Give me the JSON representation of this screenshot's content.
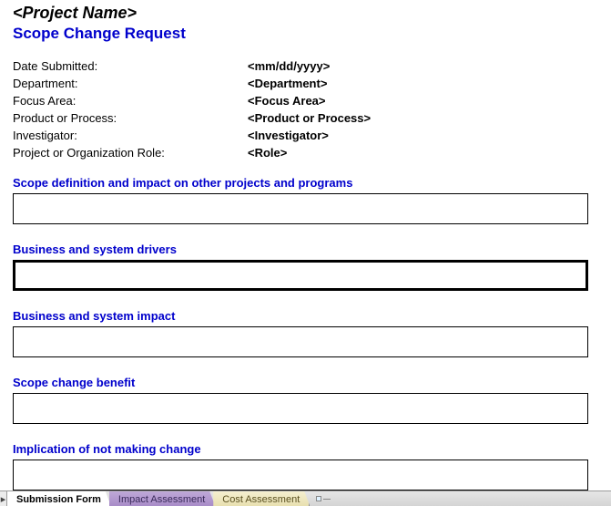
{
  "header": {
    "project_name": "<Project Name>",
    "subtitle": "Scope Change Request"
  },
  "meta": [
    {
      "label": "Date Submitted:",
      "value": "<mm/dd/yyyy>"
    },
    {
      "label": "Department:",
      "value": "<Department>"
    },
    {
      "label": "Focus Area:",
      "value": "<Focus Area>"
    },
    {
      "label": "Product or Process:",
      "value": "<Product or Process>"
    },
    {
      "label": "Investigator:",
      "value": "<Investigator>"
    },
    {
      "label": "Project or Organization Role:",
      "value": "<Role>"
    }
  ],
  "sections": [
    {
      "heading": "Scope definition and impact on other projects and programs",
      "value": ""
    },
    {
      "heading": "Business and system drivers",
      "value": ""
    },
    {
      "heading": "Business and system impact",
      "value": ""
    },
    {
      "heading": "Scope change benefit",
      "value": ""
    },
    {
      "heading": "Implication of not making change",
      "value": ""
    }
  ],
  "tabs": {
    "nav_glyph": "▸",
    "items": [
      {
        "label": "Submission Form",
        "state": "active"
      },
      {
        "label": "Impact Assessment",
        "state": "inactive"
      },
      {
        "label": "Cost Assessment",
        "state": "inactive2"
      }
    ]
  }
}
